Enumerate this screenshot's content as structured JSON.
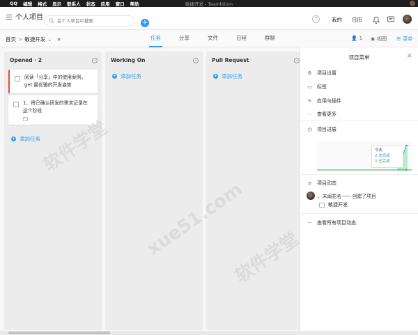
{
  "menubar": {
    "apple": "",
    "items": [
      "QQ",
      "编辑",
      "格式",
      "显示",
      "联系人",
      "状态",
      "应用",
      "窗口",
      "帮助"
    ],
    "window_title": "敏捷开发 - Teambition"
  },
  "header": {
    "project_title": "个人项目",
    "search_placeholder": "在个人项目中搜索",
    "mine": "我的",
    "calendar": "日历"
  },
  "subnav": {
    "crumb_home": "首页",
    "crumb_sep": ">",
    "crumb_project": "敏捷开发",
    "tabs": [
      "任务",
      "分享",
      "文件",
      "日程",
      "群聊"
    ],
    "members": "1",
    "view": "视图",
    "menu": "菜单"
  },
  "board": {
    "columns": [
      {
        "title": "Opened · 2",
        "cards": [
          {
            "text": "阅读「分享」中的使用案例，get 最优雅的开发姿势"
          },
          {
            "text": "1、将已确认研发的需求记录在这个阶段"
          }
        ],
        "add_label": "添加任务"
      },
      {
        "title": "Working On",
        "cards": [],
        "add_label": "添加任务"
      },
      {
        "title": "Pull Request",
        "cards": [],
        "add_label": "添加任务"
      }
    ]
  },
  "panel": {
    "title": "项目菜单",
    "items": [
      "项目设置",
      "标签",
      "应用与插件",
      "查看更多"
    ],
    "progress_label": "项目进展",
    "progress_tooltip": {
      "today": "今天",
      "undone": "2 未完成",
      "done": "0 已完成"
    },
    "activity_label": "项目动态",
    "activity_text": "、末闻花名—— 创建了项目",
    "activity_project": "敏捷开发",
    "all_activity": "查看所有项目动态"
  },
  "watermark": "软件学堂 xue51.com",
  "colors": {
    "accent": "#2d9af0",
    "done_green": "#3bb54a",
    "card_flag": "#e74c3c"
  }
}
